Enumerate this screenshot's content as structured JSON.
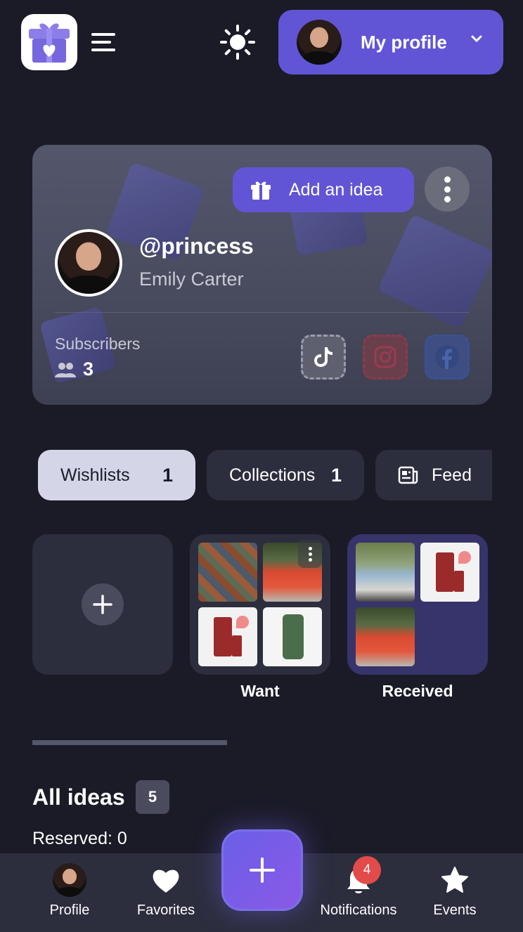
{
  "header": {
    "logo": "gift-heart-logo",
    "menu_icon": "hamburger-menu-icon",
    "theme_icon": "sun-icon",
    "profile_button": {
      "label": "My profile",
      "icon": "chevron-down-icon"
    }
  },
  "profile_card": {
    "add_idea_label": "Add an idea",
    "username": "@princess",
    "full_name": "Emily Carter",
    "subscribers_label": "Subscribers",
    "subscribers_count": "3",
    "socials": [
      "tiktok-icon",
      "instagram-icon",
      "facebook-icon"
    ]
  },
  "tabs": [
    {
      "label": "Wishlists",
      "count": "1",
      "active": true
    },
    {
      "label": "Collections",
      "count": "1",
      "active": false
    },
    {
      "label": "Feed",
      "icon": "newspaper-icon",
      "active": false
    }
  ],
  "wishlists": [
    {
      "title": "Want"
    },
    {
      "title": "Received"
    }
  ],
  "all_ideas": {
    "title": "All ideas",
    "count": "5",
    "reserved": "Reserved: 0"
  },
  "bottom_nav": {
    "profile": "Profile",
    "favorites": "Favorites",
    "notifications": "Notifications",
    "notifications_badge": "4",
    "events": "Events"
  },
  "colors": {
    "background": "#1a1b27",
    "accent": "#6155d6",
    "surface": "#2c2d3d",
    "badge": "#e34b4b"
  }
}
